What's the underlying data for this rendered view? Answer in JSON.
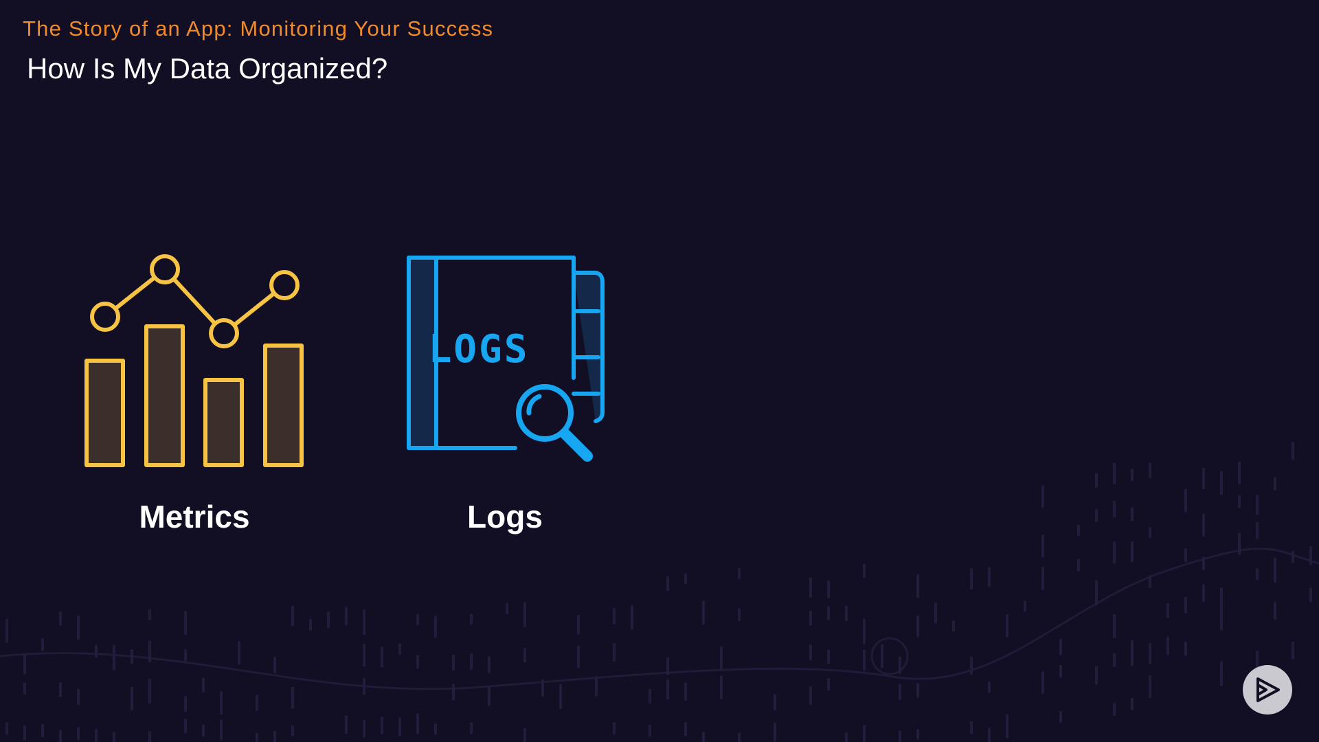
{
  "slide": {
    "course_title": "The Story of an App: Monitoring Your Success",
    "title": "How Is My Data Organized?",
    "items": [
      {
        "label": "Metrics",
        "icon": "bar-line-chart-icon",
        "color": "#f6c343"
      },
      {
        "label": "Logs",
        "icon": "log-book-magnifier-icon",
        "icon_text": "LOGS",
        "color": "#16a6f2"
      }
    ]
  },
  "player": {
    "play_icon": "play-icon"
  },
  "colors": {
    "background": "#120e23",
    "accent": "#f08a2b",
    "title": "#ffffff",
    "metrics": "#f6c343",
    "logs": "#16a6f2"
  }
}
